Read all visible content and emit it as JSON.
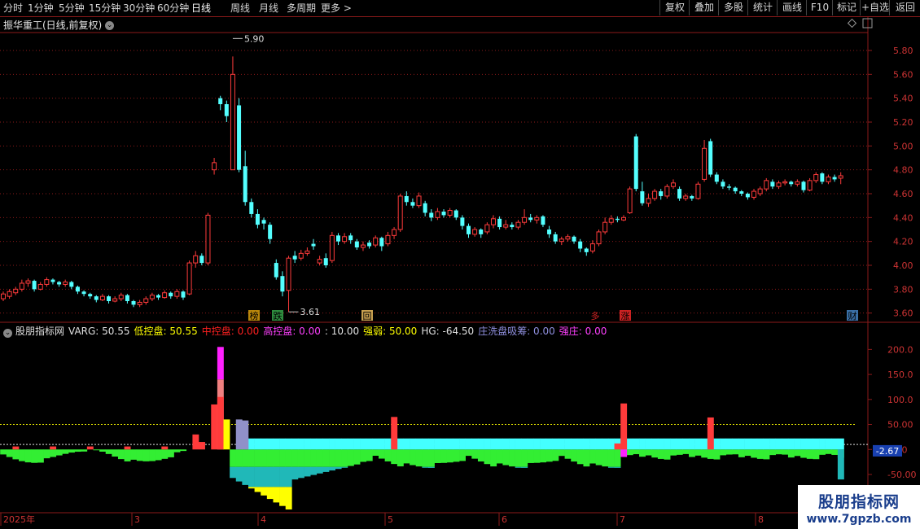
{
  "toolbar": {
    "periods": [
      "分时",
      "1分钟",
      "5分钟",
      "15分钟",
      "30分钟",
      "60分钟",
      "日线",
      "周线",
      "月线",
      "多周期",
      "更多 >"
    ],
    "active_period": "日线",
    "right_buttons": [
      "复权",
      "叠加",
      "多股",
      "统计",
      "画线",
      "F10",
      "标记",
      "+自选",
      "返回"
    ]
  },
  "main_chart": {
    "title": "振华重工(日线,前复权)",
    "high_label": "5.90",
    "low_label": "3.61",
    "y_ticks": [
      "5.80",
      "5.60",
      "5.40",
      "5.20",
      "5.00",
      "4.80",
      "4.60",
      "4.40",
      "4.20",
      "4.00",
      "3.80",
      "3.60"
    ],
    "markers": [
      {
        "text": "榜",
        "color": "#b8860b"
      },
      {
        "text": "跌",
        "color": "#2e8b3e"
      },
      {
        "text": "回",
        "color": "#c8a050"
      },
      {
        "text": "多",
        "color": "#cc2222"
      },
      {
        "text": "涨",
        "color": "#cc2222"
      },
      {
        "text": "财",
        "color": "#3a6ea5"
      }
    ]
  },
  "indicator": {
    "name": "股朋指标网",
    "items": [
      {
        "label": "VARG: 50.55",
        "color": "#e0e0e0"
      },
      {
        "label": "低控盘: 50.55",
        "color": "#ffff00"
      },
      {
        "label": "中控盘: 0.00",
        "color": "#ff2020"
      },
      {
        "label": "高控盘: 0.00",
        "color": "#ff40ff"
      },
      {
        "label": ": 10.00",
        "color": "#e0e0e0"
      },
      {
        "label": "强弱: 50.00",
        "color": "#ffff00"
      },
      {
        "label": "HG: -64.50",
        "color": "#e0e0e0"
      },
      {
        "label": "庄洗盘吸筹: 0.00",
        "color": "#9090e0"
      },
      {
        "label": "强庄: 0.00",
        "color": "#ff40ff"
      }
    ],
    "y_ticks": [
      "200.0",
      "150.0",
      "100.0",
      "50.00",
      "0.00",
      "-50.00",
      "-100.0"
    ],
    "current_value": "-2.67"
  },
  "x_axis": [
    "2025年",
    "3",
    "4",
    "5",
    "6",
    "7",
    "8"
  ],
  "watermark": {
    "line1": "股朋指标网",
    "line2": "www.7gpzb.com"
  },
  "colors": {
    "up": "#ff3b3b",
    "down": "#54ffff",
    "grid": "#8b1a1a"
  },
  "chart_data": {
    "type": "candlestick",
    "ylim": [
      3.55,
      5.95
    ],
    "x_labels": [
      "2025年",
      "3",
      "4",
      "5",
      "6",
      "7",
      "8"
    ],
    "candles": [
      [
        3.72,
        3.76,
        3.78,
        3.7
      ],
      [
        3.74,
        3.78,
        3.8,
        3.72
      ],
      [
        3.77,
        3.8,
        3.82,
        3.75
      ],
      [
        3.8,
        3.85,
        3.88,
        3.78
      ],
      [
        3.85,
        3.87,
        3.89,
        3.82
      ],
      [
        3.87,
        3.8,
        3.88,
        3.78
      ],
      [
        3.8,
        3.84,
        3.86,
        3.79
      ],
      [
        3.84,
        3.88,
        3.9,
        3.82
      ],
      [
        3.88,
        3.86,
        3.89,
        3.84
      ],
      [
        3.86,
        3.84,
        3.87,
        3.82
      ],
      [
        3.84,
        3.86,
        3.88,
        3.82
      ],
      [
        3.86,
        3.82,
        3.87,
        3.8
      ],
      [
        3.82,
        3.78,
        3.83,
        3.76
      ],
      [
        3.78,
        3.76,
        3.79,
        3.74
      ],
      [
        3.76,
        3.74,
        3.77,
        3.72
      ],
      [
        3.74,
        3.71,
        3.75,
        3.69
      ],
      [
        3.71,
        3.74,
        3.76,
        3.7
      ],
      [
        3.74,
        3.7,
        3.75,
        3.68
      ],
      [
        3.7,
        3.72,
        3.74,
        3.69
      ],
      [
        3.72,
        3.75,
        3.77,
        3.7
      ],
      [
        3.75,
        3.7,
        3.76,
        3.68
      ],
      [
        3.7,
        3.67,
        3.71,
        3.65
      ],
      [
        3.67,
        3.69,
        3.71,
        3.65
      ],
      [
        3.69,
        3.72,
        3.74,
        3.67
      ],
      [
        3.72,
        3.75,
        3.77,
        3.7
      ],
      [
        3.75,
        3.73,
        3.76,
        3.71
      ],
      [
        3.73,
        3.77,
        3.79,
        3.72
      ],
      [
        3.77,
        3.74,
        3.78,
        3.72
      ],
      [
        3.74,
        3.78,
        3.8,
        3.72
      ],
      [
        3.78,
        3.73,
        3.79,
        3.71
      ],
      [
        3.76,
        4.02,
        4.04,
        3.75
      ],
      [
        4.02,
        4.08,
        4.12,
        3.98
      ],
      [
        4.08,
        4.02,
        4.1,
        4.0
      ],
      [
        4.02,
        4.42,
        4.44,
        4.0
      ],
      [
        4.8,
        4.86,
        4.9,
        4.76
      ],
      [
        5.4,
        5.35,
        5.42,
        5.3
      ],
      [
        5.35,
        5.25,
        5.38,
        5.2
      ],
      [
        4.8,
        5.6,
        5.75,
        4.8
      ],
      [
        5.34,
        4.8,
        5.4,
        4.78
      ],
      [
        4.83,
        4.53,
        4.96,
        4.5
      ],
      [
        4.53,
        4.43,
        4.56,
        4.4
      ],
      [
        4.43,
        4.34,
        4.47,
        4.31
      ],
      [
        4.38,
        4.35,
        4.4,
        4.3
      ],
      [
        4.34,
        4.22,
        4.36,
        4.18
      ],
      [
        4.02,
        3.9,
        4.05,
        3.88
      ],
      [
        3.91,
        3.78,
        3.95,
        3.74
      ],
      [
        3.79,
        4.06,
        4.08,
        3.61
      ],
      [
        4.08,
        4.05,
        4.12,
        4.02
      ],
      [
        4.06,
        4.1,
        4.13,
        4.04
      ],
      [
        4.1,
        4.12,
        4.15,
        4.08
      ],
      [
        4.18,
        4.16,
        4.22,
        4.13
      ],
      [
        4.02,
        4.05,
        4.08,
        4.0
      ],
      [
        4.06,
        4.0,
        4.1,
        3.98
      ],
      [
        4.04,
        4.25,
        4.28,
        4.02
      ],
      [
        4.25,
        4.2,
        4.27,
        4.17
      ],
      [
        4.2,
        4.24,
        4.27,
        4.18
      ],
      [
        4.25,
        4.21,
        4.27,
        4.18
      ],
      [
        4.2,
        4.15,
        4.22,
        4.13
      ],
      [
        4.15,
        4.17,
        4.2,
        4.12
      ],
      [
        4.19,
        4.16,
        4.21,
        4.14
      ],
      [
        4.17,
        4.23,
        4.25,
        4.15
      ],
      [
        4.23,
        4.16,
        4.24,
        4.12
      ],
      [
        4.18,
        4.25,
        4.28,
        4.16
      ],
      [
        4.25,
        4.3,
        4.32,
        4.22
      ],
      [
        4.3,
        4.58,
        4.6,
        4.28
      ],
      [
        4.58,
        4.53,
        4.62,
        4.5
      ],
      [
        4.53,
        4.5,
        4.56,
        4.48
      ],
      [
        4.5,
        4.58,
        4.61,
        4.48
      ],
      [
        4.52,
        4.44,
        4.54,
        4.41
      ],
      [
        4.44,
        4.4,
        4.47,
        4.37
      ],
      [
        4.4,
        4.45,
        4.48,
        4.38
      ],
      [
        4.45,
        4.42,
        4.47,
        4.4
      ],
      [
        4.42,
        4.46,
        4.48,
        4.4
      ],
      [
        4.46,
        4.4,
        4.47,
        4.38
      ],
      [
        4.4,
        4.33,
        4.42,
        4.3
      ],
      [
        4.33,
        4.26,
        4.35,
        4.23
      ],
      [
        4.26,
        4.3,
        4.32,
        4.24
      ],
      [
        4.3,
        4.26,
        4.31,
        4.23
      ],
      [
        4.28,
        4.34,
        4.36,
        4.26
      ],
      [
        4.34,
        4.39,
        4.42,
        4.31
      ],
      [
        4.39,
        4.32,
        4.41,
        4.3
      ],
      [
        4.32,
        4.34,
        4.38,
        4.3
      ],
      [
        4.34,
        4.32,
        4.36,
        4.3
      ],
      [
        4.32,
        4.36,
        4.38,
        4.3
      ],
      [
        4.36,
        4.4,
        4.47,
        4.34
      ],
      [
        4.4,
        4.38,
        4.43,
        4.36
      ],
      [
        4.38,
        4.4,
        4.42,
        4.35
      ],
      [
        4.41,
        4.34,
        4.42,
        4.32
      ],
      [
        4.3,
        4.26,
        4.33,
        4.23
      ],
      [
        4.26,
        4.2,
        4.28,
        4.18
      ],
      [
        4.2,
        4.22,
        4.24,
        4.17
      ],
      [
        4.22,
        4.24,
        4.26,
        4.2
      ],
      [
        4.24,
        4.2,
        4.25,
        4.18
      ],
      [
        4.2,
        4.14,
        4.22,
        4.11
      ],
      [
        4.14,
        4.11,
        4.15,
        4.08
      ],
      [
        4.12,
        4.18,
        4.21,
        4.1
      ],
      [
        4.18,
        4.28,
        4.3,
        4.16
      ],
      [
        4.28,
        4.36,
        4.4,
        4.26
      ],
      [
        4.36,
        4.39,
        4.42,
        4.34
      ],
      [
        4.39,
        4.38,
        4.41,
        4.36
      ],
      [
        4.38,
        4.4,
        4.42,
        4.37
      ],
      [
        4.44,
        4.64,
        4.66,
        4.43
      ],
      [
        5.08,
        4.64,
        5.1,
        4.62
      ],
      [
        4.62,
        4.52,
        4.7,
        4.5
      ],
      [
        4.52,
        4.56,
        4.6,
        4.49
      ],
      [
        4.56,
        4.62,
        4.64,
        4.54
      ],
      [
        4.62,
        4.58,
        4.64,
        4.55
      ],
      [
        4.58,
        4.66,
        4.68,
        4.56
      ],
      [
        4.66,
        4.69,
        4.72,
        4.64
      ],
      [
        4.64,
        4.56,
        4.66,
        4.54
      ],
      [
        4.56,
        4.58,
        4.6,
        4.54
      ],
      [
        4.58,
        4.56,
        4.59,
        4.54
      ],
      [
        4.56,
        4.68,
        4.7,
        4.55
      ],
      [
        4.72,
        4.98,
        5.05,
        4.7
      ],
      [
        5.04,
        4.76,
        5.06,
        4.74
      ],
      [
        4.76,
        4.7,
        4.78,
        4.68
      ],
      [
        4.7,
        4.66,
        4.72,
        4.64
      ],
      [
        4.66,
        4.65,
        4.68,
        4.63
      ],
      [
        4.65,
        4.62,
        4.66,
        4.6
      ],
      [
        4.62,
        4.6,
        4.63,
        4.58
      ],
      [
        4.6,
        4.57,
        4.61,
        4.55
      ],
      [
        4.57,
        4.62,
        4.64,
        4.55
      ],
      [
        4.6,
        4.64,
        4.66,
        4.58
      ],
      [
        4.64,
        4.71,
        4.73,
        4.62
      ],
      [
        4.7,
        4.66,
        4.72,
        4.64
      ],
      [
        4.66,
        4.69,
        4.71,
        4.64
      ],
      [
        4.69,
        4.7,
        4.72,
        4.67
      ],
      [
        4.7,
        4.68,
        4.71,
        4.66
      ],
      [
        4.68,
        4.7,
        4.72,
        4.66
      ],
      [
        4.7,
        4.63,
        4.71,
        4.61
      ],
      [
        4.63,
        4.71,
        4.73,
        4.62
      ],
      [
        4.71,
        4.76,
        4.78,
        4.69
      ],
      [
        4.77,
        4.7,
        4.78,
        4.68
      ],
      [
        4.7,
        4.74,
        4.76,
        4.68
      ],
      [
        4.74,
        4.72,
        4.76,
        4.7
      ],
      [
        4.73,
        4.75,
        4.78,
        4.68
      ]
    ],
    "indicator_ylim": [
      -120,
      225
    ],
    "indicator_bars_note": "stacked histogram: red/yellow/magenta/lavender positive, green/teal/yellow negative; cyan positive band"
  }
}
